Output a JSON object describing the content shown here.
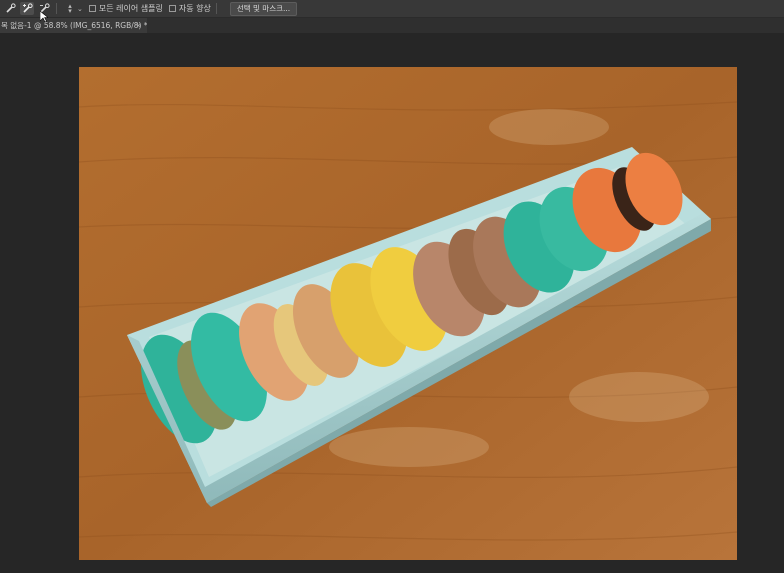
{
  "options_bar": {
    "tools": [
      {
        "icon": "brush-icon",
        "active": false
      },
      {
        "icon": "brush-add-icon",
        "active": true
      },
      {
        "icon": "brush-subtract-icon",
        "active": false
      }
    ],
    "sample_all_layers_label": "모든 레이어 샘플링",
    "auto_enhance_label": "자동 향상",
    "select_and_mask_label": "선택 및 마스크..."
  },
  "document_tab": {
    "title": "목 없음-1 @ 58.8% (IMG_6516, RGB/8) *",
    "close_glyph": "×"
  },
  "colors": {
    "table_wood": "#a8642a",
    "box": "#a9d3d3",
    "macaron_teal": "#2fb39a",
    "macaron_yellow": "#e9c23a",
    "macaron_orange": "#e8783d"
  }
}
